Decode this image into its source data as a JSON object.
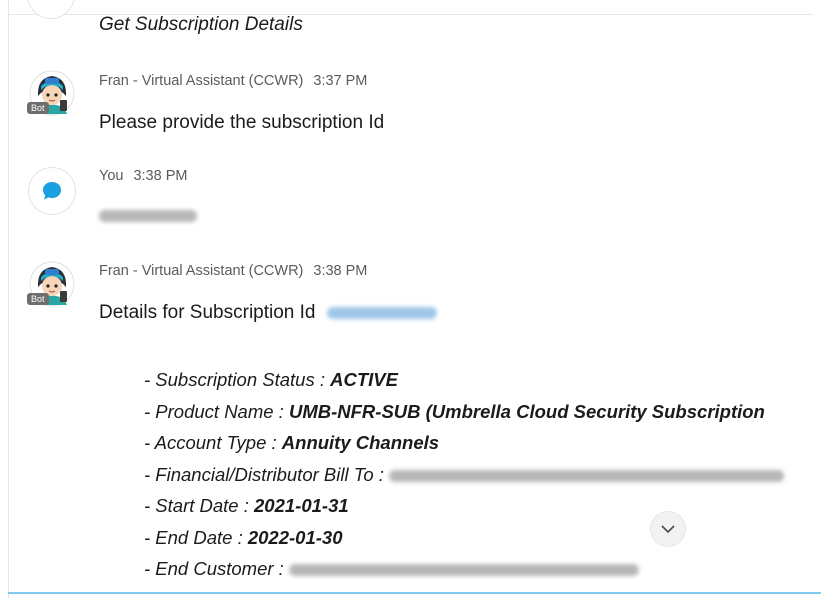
{
  "top_message": "Get Subscription Details",
  "messages": [
    {
      "sender": "Fran - Virtual Assistant (CCWR)",
      "time": "3:37 PM",
      "badge": "Bot",
      "text": "Please provide the subscription Id"
    },
    {
      "sender": "You",
      "time": "3:38 PM",
      "text_redacted": true
    },
    {
      "sender": "Fran - Virtual Assistant (CCWR)",
      "time": "3:38 PM",
      "badge": "Bot",
      "text": "Details for Subscription Id"
    }
  ],
  "details": [
    {
      "label": "- Subscription Status : ",
      "value": "ACTIVE"
    },
    {
      "label": "- Product Name : ",
      "value": "UMB-NFR-SUB (Umbrella Cloud Security Subscription"
    },
    {
      "label": "- Account Type : ",
      "value": "Annuity Channels"
    },
    {
      "label": "- Financial/Distributor Bill To : ",
      "value": ""
    },
    {
      "label": "- Start Date : ",
      "value": "2021-01-31"
    },
    {
      "label": "- End Date : ",
      "value": "2022-01-30"
    },
    {
      "label": "- End Customer : ",
      "value": ""
    }
  ],
  "icons": {
    "user": "chat-bubble-icon",
    "scroll": "chevron-down-icon"
  },
  "colors": {
    "accent": "#1a9fe0",
    "bottom_rule": "#7ec9ee"
  }
}
